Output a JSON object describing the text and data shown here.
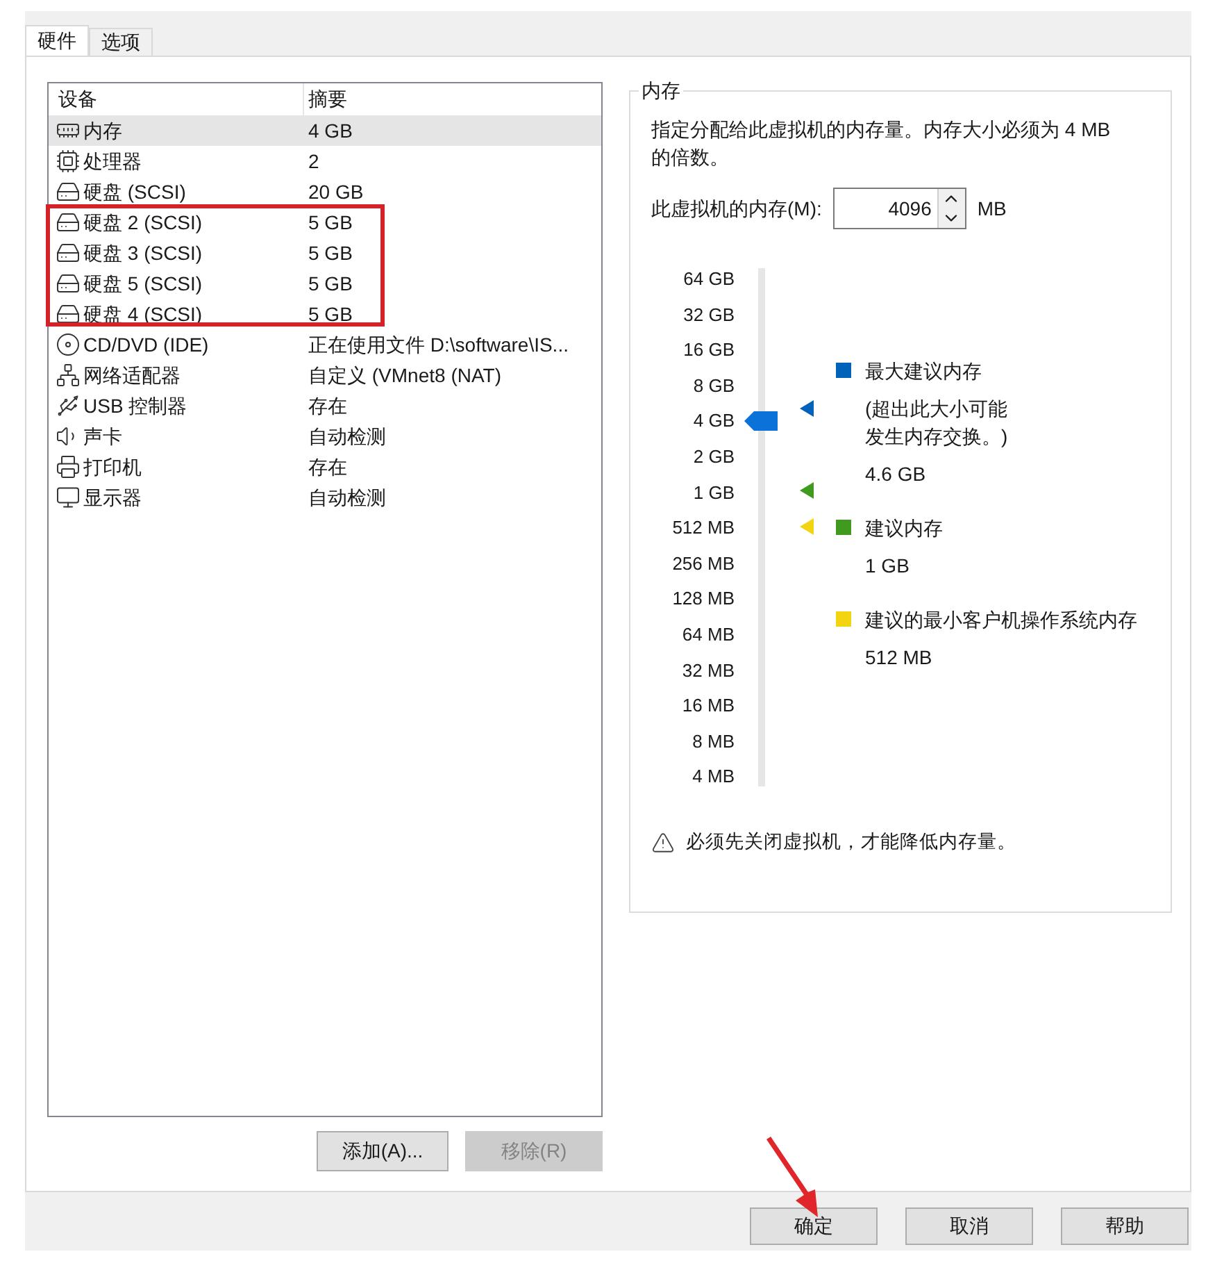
{
  "tabs": [
    {
      "label": "硬件",
      "selected": true
    },
    {
      "label": "选项",
      "selected": false
    }
  ],
  "device_table": {
    "columns": [
      "设备",
      "摘要"
    ],
    "rows": [
      {
        "kind": "memory",
        "device": "内存",
        "summary": "4 GB",
        "selected": true
      },
      {
        "kind": "cpu",
        "device": "处理器",
        "summary": "2",
        "selected": false
      },
      {
        "kind": "disk",
        "device": "硬盘 (SCSI)",
        "summary": "20 GB",
        "selected": false
      },
      {
        "kind": "disk",
        "device": "硬盘 2 (SCSI)",
        "summary": "5 GB",
        "selected": false
      },
      {
        "kind": "disk",
        "device": "硬盘 3 (SCSI)",
        "summary": "5 GB",
        "selected": false
      },
      {
        "kind": "disk",
        "device": "硬盘 5 (SCSI)",
        "summary": "5 GB",
        "selected": false
      },
      {
        "kind": "disk",
        "device": "硬盘 4 (SCSI)",
        "summary": "5 GB",
        "selected": false
      },
      {
        "kind": "cd",
        "device": "CD/DVD (IDE)",
        "summary": "正在使用文件 D:\\software\\IS...",
        "selected": false
      },
      {
        "kind": "network",
        "device": "网络适配器",
        "summary": "自定义 (VMnet8 (NAT)",
        "selected": false
      },
      {
        "kind": "usb",
        "device": "USB 控制器",
        "summary": "存在",
        "selected": false
      },
      {
        "kind": "sound",
        "device": "声卡",
        "summary": "自动检测",
        "selected": false
      },
      {
        "kind": "printer",
        "device": "打印机",
        "summary": "存在",
        "selected": false
      },
      {
        "kind": "display",
        "device": "显示器",
        "summary": "自动检测",
        "selected": false
      }
    ]
  },
  "device_buttons": [
    {
      "label": "添加(A)...",
      "disabled": false
    },
    {
      "label": "移除(R)",
      "disabled": true
    }
  ],
  "memory_group": {
    "title": "内存",
    "description": "指定分配给此虚拟机的内存量。内存大小必须为 4 MB 的倍数。",
    "field_label": "此虚拟机的内存(M):",
    "value": "4096",
    "unit": "MB",
    "scale": {
      "labels": [
        "64 GB",
        "32 GB",
        "16 GB",
        "8 GB",
        "4 GB",
        "2 GB",
        "1 GB",
        "512 MB",
        "256 MB",
        "128 MB",
        "64 MB",
        "32 MB",
        "16 MB",
        "8 MB",
        "4 MB"
      ],
      "level": 0.714
    },
    "legend": [
      {
        "color": "#0062b8",
        "title": "最大建议内存",
        "note": "(超出此大小可能发生内存交换。)",
        "value": "4.6 GB"
      },
      {
        "color": "#3f9a1f",
        "title": "建议内存",
        "value": "1 GB"
      },
      {
        "color": "#f2d410",
        "title": "建议的最小客户机操作系统内存",
        "value": "512 MB"
      }
    ],
    "warning": "必须先关闭虚拟机，才能降低内存量。"
  },
  "dialog_buttons": [
    {
      "label": "确定"
    },
    {
      "label": "取消"
    },
    {
      "label": "帮助"
    }
  ]
}
